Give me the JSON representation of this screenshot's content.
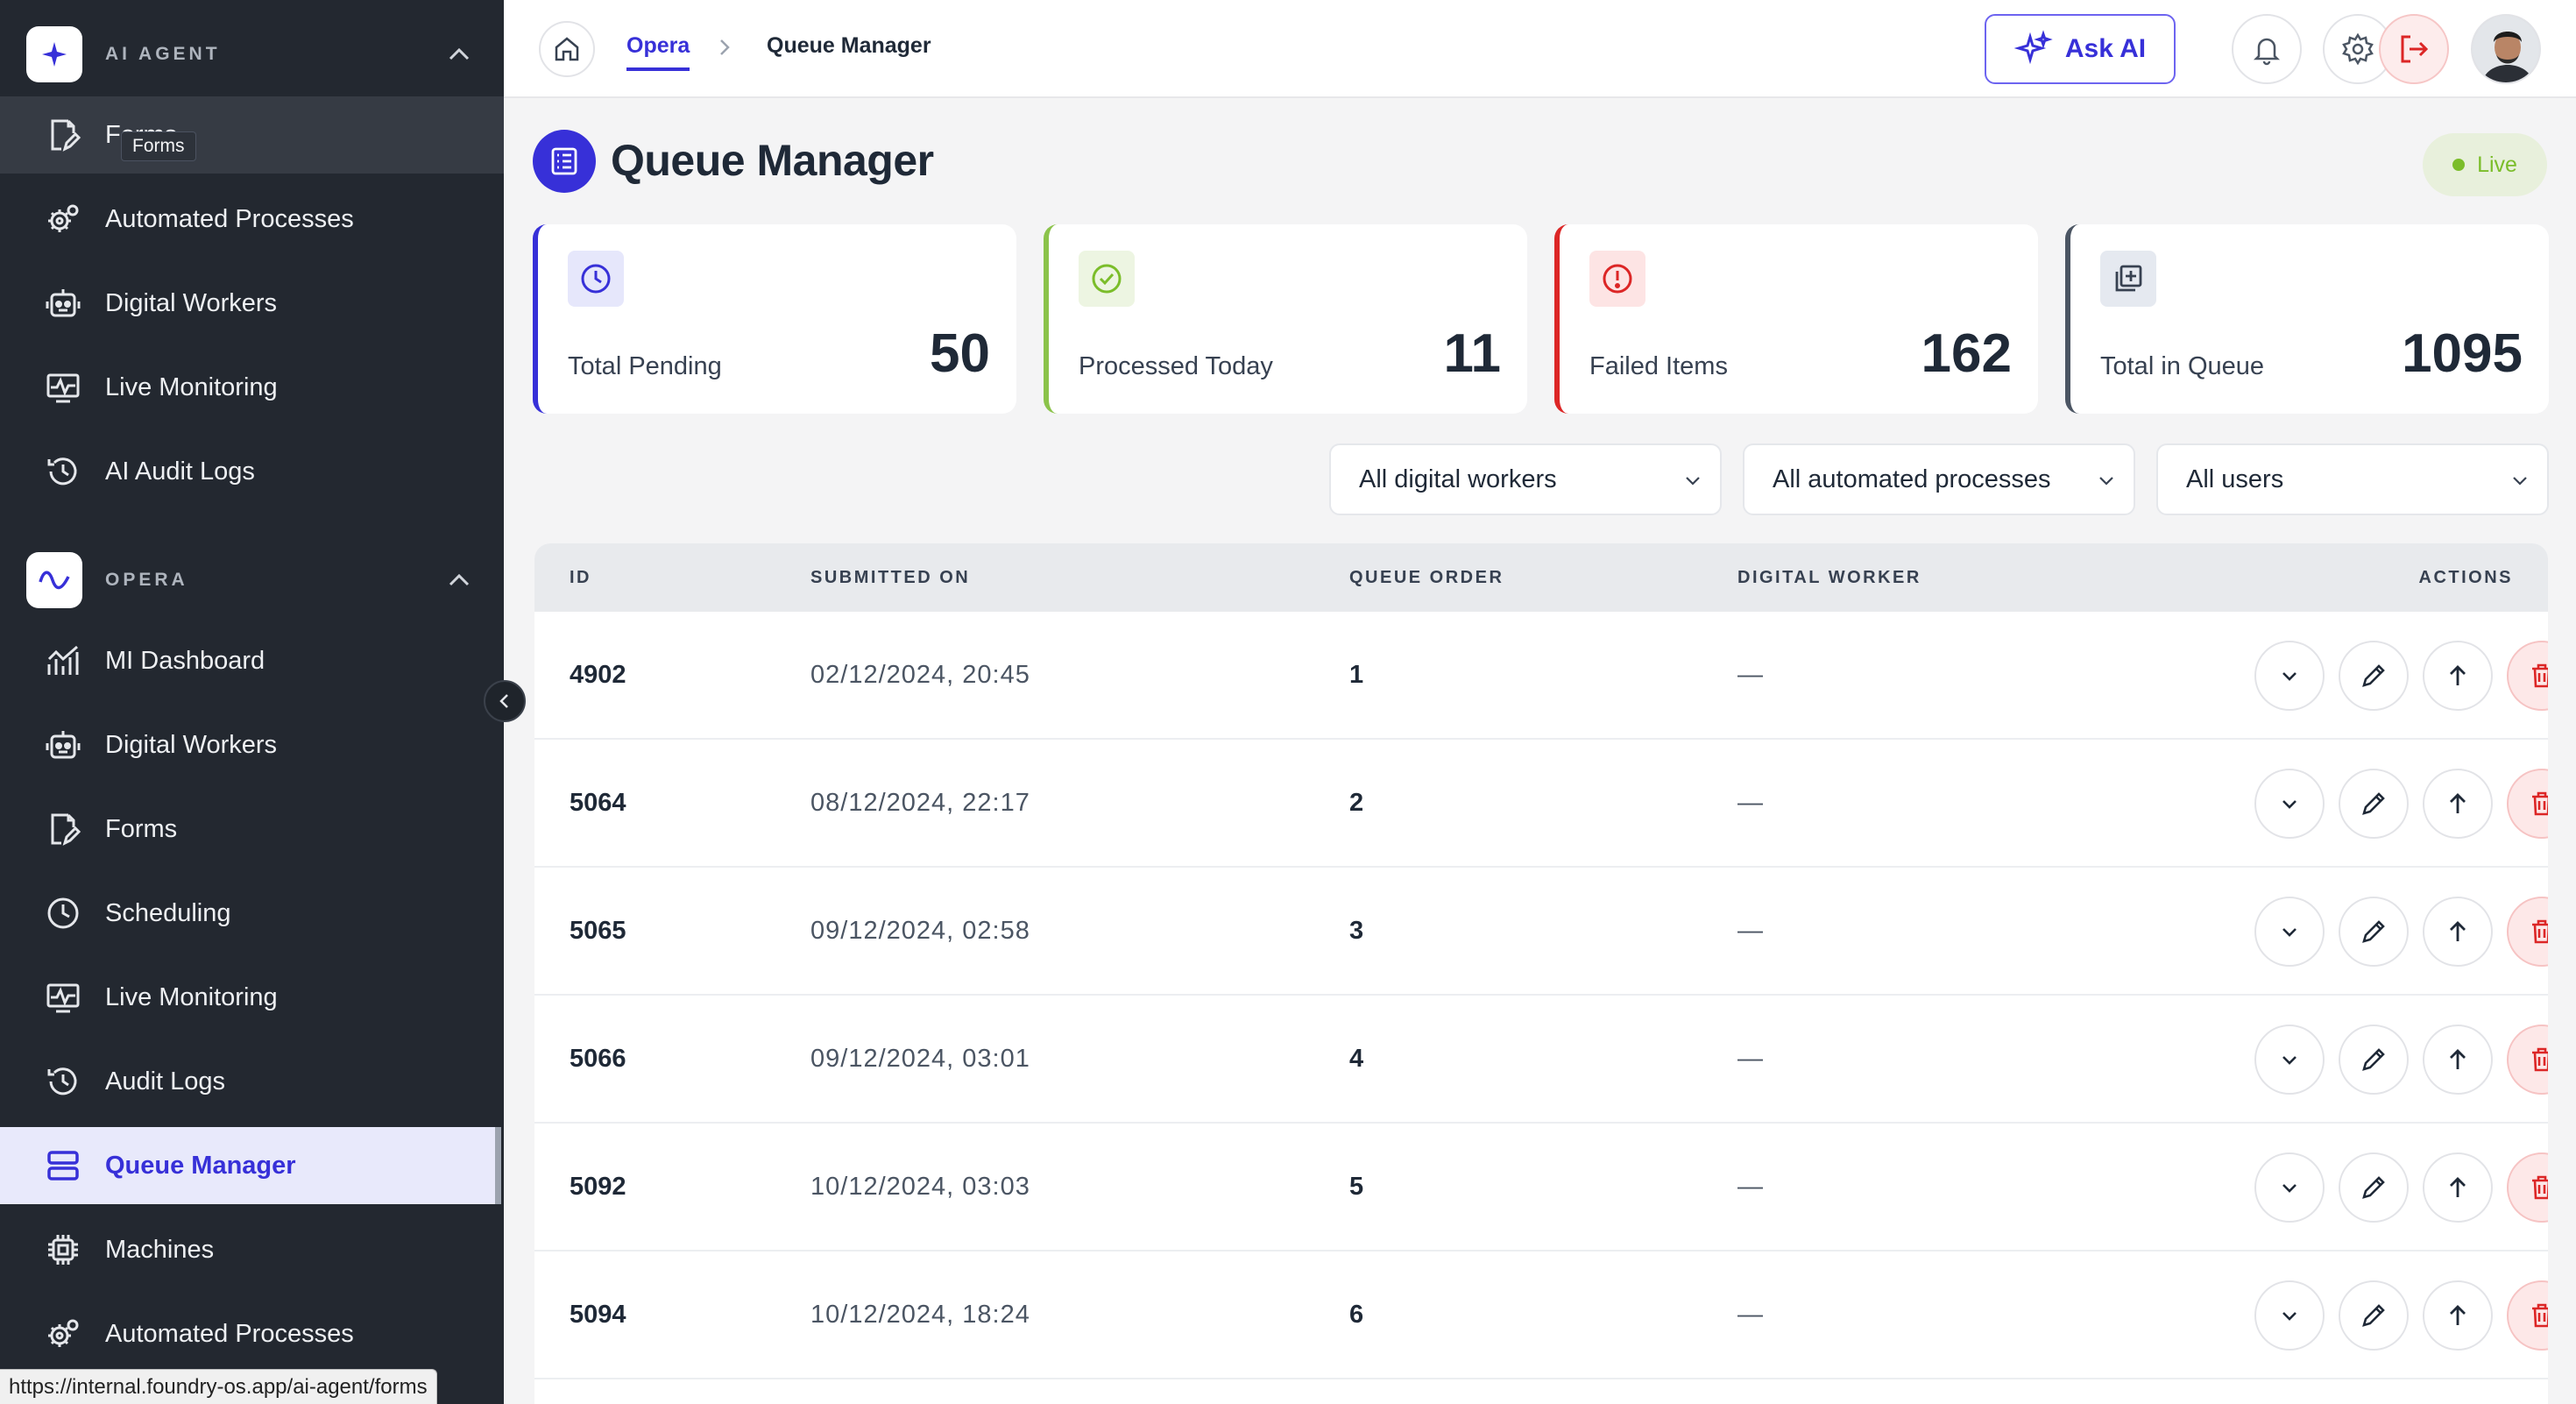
{
  "sidebar": {
    "ai_agent": {
      "title": "AI AGENT",
      "items": [
        {
          "label": "Forms",
          "icon": "form-edit-icon"
        },
        {
          "label": "Automated Processes",
          "icon": "gears-icon"
        },
        {
          "label": "Digital Workers",
          "icon": "robot-icon"
        },
        {
          "label": "Live Monitoring",
          "icon": "monitor-icon"
        },
        {
          "label": "AI Audit Logs",
          "icon": "history-icon"
        }
      ]
    },
    "tooltip": "Forms",
    "opera": {
      "title": "OPERA",
      "items": [
        {
          "label": "MI Dashboard",
          "icon": "chart-icon"
        },
        {
          "label": "Digital Workers",
          "icon": "robot-icon"
        },
        {
          "label": "Forms",
          "icon": "form-edit-icon"
        },
        {
          "label": "Scheduling",
          "icon": "clock-icon"
        },
        {
          "label": "Live Monitoring",
          "icon": "monitor-icon"
        },
        {
          "label": "Audit Logs",
          "icon": "history-icon"
        },
        {
          "label": "Queue Manager",
          "icon": "queue-icon"
        },
        {
          "label": "Machines",
          "icon": "chip-icon"
        },
        {
          "label": "Automated Processes",
          "icon": "gears-icon"
        }
      ]
    }
  },
  "topbar": {
    "breadcrumb": [
      "Opera",
      "Queue Manager"
    ],
    "ask_ai": "Ask AI"
  },
  "page": {
    "title": "Queue Manager",
    "live": "Live"
  },
  "stats": [
    {
      "label": "Total Pending",
      "value": "50",
      "color": "#3730d8"
    },
    {
      "label": "Processed Today",
      "value": "11",
      "color": "#8bc34a"
    },
    {
      "label": "Failed Items",
      "value": "162",
      "color": "#dc2626"
    },
    {
      "label": "Total in Queue",
      "value": "1095",
      "color": "#4b5563"
    }
  ],
  "filters": [
    "All digital workers",
    "All automated processes",
    "All users"
  ],
  "table": {
    "headers": [
      "ID",
      "SUBMITTED ON",
      "QUEUE ORDER",
      "DIGITAL WORKER",
      "ACTIONS"
    ],
    "rows": [
      {
        "id": "4902",
        "submitted": "02/12/2024, 20:45",
        "order": "1",
        "worker": "—"
      },
      {
        "id": "5064",
        "submitted": "08/12/2024, 22:17",
        "order": "2",
        "worker": "—"
      },
      {
        "id": "5065",
        "submitted": "09/12/2024, 02:58",
        "order": "3",
        "worker": "—"
      },
      {
        "id": "5066",
        "submitted": "09/12/2024, 03:01",
        "order": "4",
        "worker": "—"
      },
      {
        "id": "5092",
        "submitted": "10/12/2024, 03:03",
        "order": "5",
        "worker": "—"
      },
      {
        "id": "5094",
        "submitted": "10/12/2024, 18:24",
        "order": "6",
        "worker": "—"
      }
    ]
  },
  "status_url": "https://internal.foundry-os.app/ai-agent/forms"
}
